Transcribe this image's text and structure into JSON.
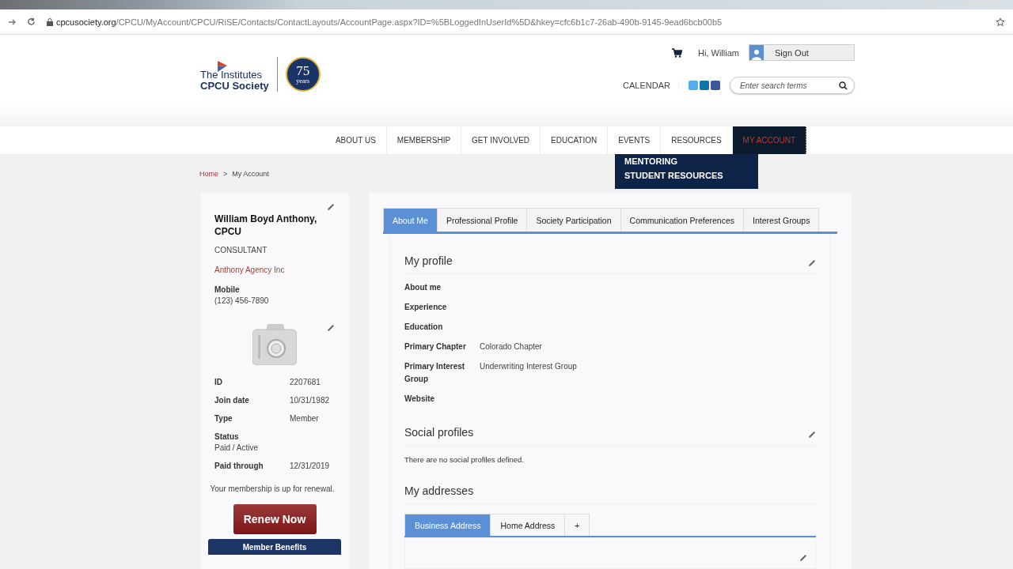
{
  "browser": {
    "url_host": "cpcusociety.org",
    "url_path": "/CPCU/MyAccount/CPCU/RiSE/Contacts/ContactLayouts/AccountPage.aspx?ID=%5BLoggedInUserId%5D&hkey=cfc6b1c7-26ab-490b-9145-9ead6bcb00b5"
  },
  "header": {
    "logo_line1": "The Institutes",
    "logo_line2": "CPCU Society",
    "badge_number": "75",
    "badge_word": "years",
    "greeting": "Hi, William",
    "sign_out": "Sign Out",
    "calendar": "CALENDAR",
    "search": {
      "placeholder": "Enter search terms"
    }
  },
  "nav": [
    {
      "label": "ABOUT US",
      "selected": false
    },
    {
      "label": "MEMBERSHIP",
      "selected": false
    },
    {
      "label": "GET INVOLVED",
      "selected": false
    },
    {
      "label": "EDUCATION",
      "selected": false
    },
    {
      "label": "EVENTS",
      "selected": false
    },
    {
      "label": "RESOURCES",
      "selected": false
    },
    {
      "label": "MY ACCOUNT",
      "selected": true
    }
  ],
  "dropdown": [
    "MENTORING",
    "STUDENT RESOURCES"
  ],
  "breadcrumb": [
    "Home",
    ">",
    "My Account"
  ],
  "member": {
    "name": "William Boyd Anthony, CPCU",
    "title": "CONSULTANT",
    "company": "Anthony Agency Inc",
    "phone_label": "Mobile",
    "phone": "(123) 456-7890",
    "facts": [
      {
        "label": "ID",
        "value": "2207681",
        "kind": "inline"
      },
      {
        "label": "Join date",
        "value": "10/31/1982",
        "kind": "inline"
      },
      {
        "label": "Type",
        "value": "Member",
        "kind": "inline"
      },
      {
        "label": "Status",
        "value": "Paid / Active",
        "kind": "stacked"
      },
      {
        "label": "Paid through",
        "value": "12/31/2019",
        "kind": "inline"
      }
    ],
    "renewal_note": "Your membership is up for renewal.",
    "renew_button": "Renew Now",
    "benefits_button": "Member Benefits"
  },
  "tabs": [
    {
      "label": "About Me",
      "selected": true
    },
    {
      "label": "Professional Profile",
      "selected": false
    },
    {
      "label": "Society Participation",
      "selected": false
    },
    {
      "label": "Communication Preferences",
      "selected": false
    },
    {
      "label": "Interest Groups",
      "selected": false
    }
  ],
  "profile": {
    "title": "My profile",
    "fields": [
      {
        "label": "About me"
      },
      {
        "label": "Experience"
      },
      {
        "label": "Education"
      },
      {
        "label": "Primary Chapter",
        "value": "Colorado Chapter"
      },
      {
        "label": "Primary Interest Group",
        "value": "Underwriting Interest Group"
      },
      {
        "label": "Website"
      }
    ]
  },
  "social": {
    "title": "Social profiles",
    "note": "There are no social profiles defined."
  },
  "addresses": {
    "title": "My addresses",
    "tabs": [
      {
        "label": "Business Address",
        "selected": true
      },
      {
        "label": "Home Address",
        "selected": false
      },
      {
        "label": "+",
        "selected": false
      }
    ]
  }
}
